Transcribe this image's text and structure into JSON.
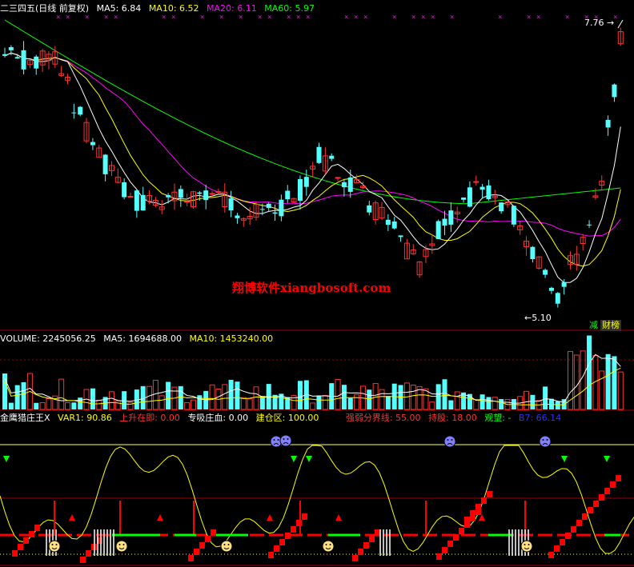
{
  "main_header": {
    "title": "二三四五(日线 前复权)",
    "ma5": "MA5: 6.84",
    "ma10": "MA10: 6.52",
    "ma20": "MA20: 6.11",
    "ma60": "MA60: 5.97"
  },
  "price_labels": {
    "high": "7.76",
    "low": "5.10"
  },
  "watermark": "翔博软件xiangbosoft.com",
  "badges": {
    "left": "减",
    "right": "财榜"
  },
  "volume_header": {
    "volume": "VOLUME: 2245056.25",
    "ma5": "MA5: 1694688.00",
    "ma10": "MA10: 1453240.00"
  },
  "indicator_header": {
    "name": "金鹰猎庄王X",
    "var1": "VAR1: 90.86",
    "shangsheng": "上升在即: 0.00",
    "zhuanxi": "专吸庄血: 0.00",
    "jiancang": "建仓区: 100.00",
    "qiangruo": "强弱分界线: 55.00",
    "chigu": "持股: 18.00",
    "guanwang": "观望: -",
    "b7": "B7: 66.14"
  },
  "colors": {
    "background": "#000000",
    "up_candle": "#ff3232",
    "down_candle": "#54ffff",
    "ma5": "#ffffff",
    "ma10": "#ffff00",
    "ma20": "#ff00ff",
    "ma60": "#00ff00",
    "grid": "#a00000",
    "indicator_line": "#ffff00",
    "step_blocks": "#ff0000"
  },
  "icons": {
    "sad_face": "sad-face-icon",
    "smiley": "smiley-icon",
    "triangle_up": "triangle-up-icon",
    "triangle_down": "triangle-down-icon"
  }
}
